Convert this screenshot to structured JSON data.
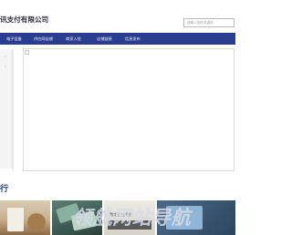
{
  "header": {
    "company_name": "讯支付有限公司",
    "search_placeholder": "请输入您的关键词"
  },
  "nav": {
    "items": [
      {
        "label": "电子设备"
      },
      {
        "label": "供应网店铺"
      },
      {
        "label": "商家入驻"
      },
      {
        "label": "店铺链接"
      },
      {
        "label": "信息发布"
      }
    ]
  },
  "sidebar": {
    "arrows": [
      "›",
      "›"
    ]
  },
  "section": {
    "title": "行"
  },
  "thumbnails": {
    "items": [
      {
        "caption": ""
      },
      {
        "caption": ""
      },
      {
        "caption": "数字签名服务"
      },
      {
        "caption": ""
      }
    ]
  },
  "watermark": {
    "text": "领航网站导航"
  },
  "colors": {
    "nav_bg": "#2a3d8f",
    "accent": "#2a3d8f"
  }
}
